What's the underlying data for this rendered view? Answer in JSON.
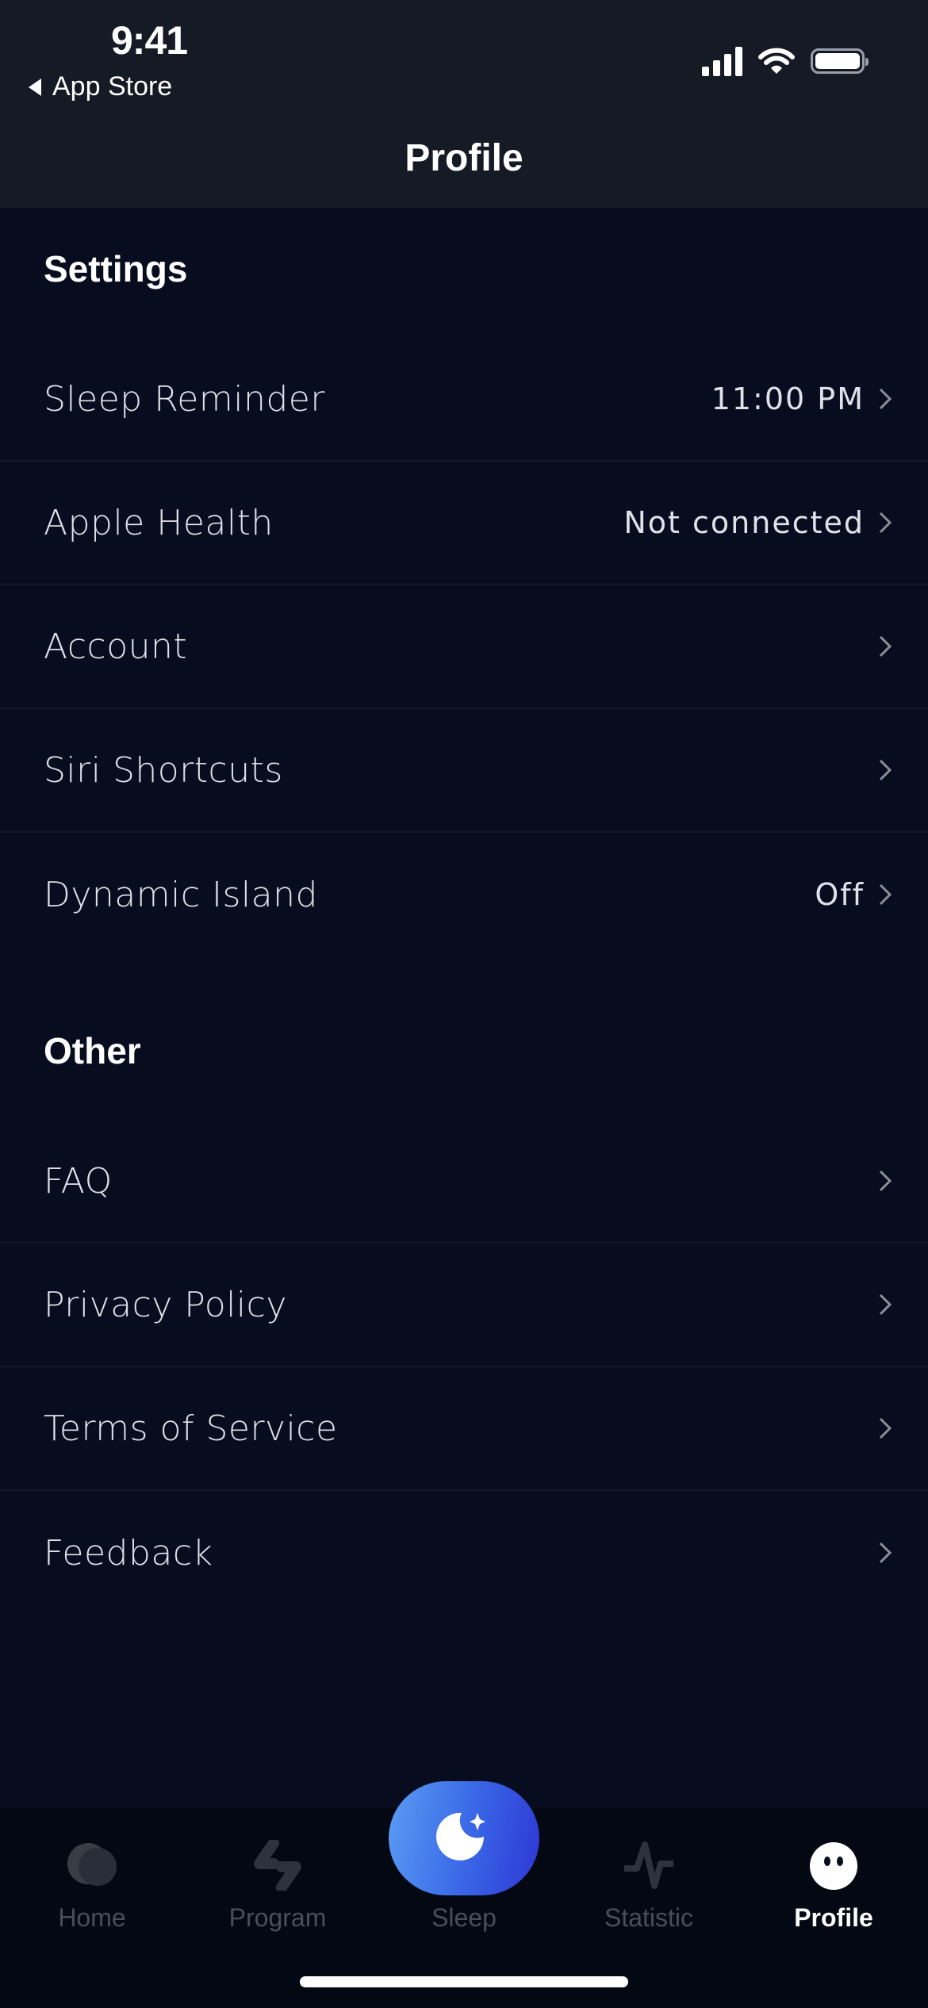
{
  "status_bar": {
    "time": "9:41",
    "back_label": "App Store"
  },
  "header": {
    "title": "Profile"
  },
  "sections": [
    {
      "title": "Settings",
      "items": [
        {
          "label": "Sleep Reminder",
          "value": "11:00 PM"
        },
        {
          "label": "Apple Health",
          "value": "Not connected"
        },
        {
          "label": "Account",
          "value": ""
        },
        {
          "label": "Siri Shortcuts",
          "value": ""
        },
        {
          "label": "Dynamic Island",
          "value": "Off"
        }
      ]
    },
    {
      "title": "Other",
      "items": [
        {
          "label": "FAQ"
        },
        {
          "label": "Privacy Policy"
        },
        {
          "label": "Terms of Service"
        },
        {
          "label": "Feedback"
        }
      ]
    }
  ],
  "tabbar": {
    "tabs": [
      {
        "label": "Home",
        "icon": "home-blob-icon",
        "active": false
      },
      {
        "label": "Program",
        "icon": "program-bolt-icon",
        "active": false
      },
      {
        "label": "Sleep",
        "icon": "moon-star-icon",
        "active": false
      },
      {
        "label": "Statistic",
        "icon": "pulse-icon",
        "active": false
      },
      {
        "label": "Profile",
        "icon": "ghost-face-icon",
        "active": true
      }
    ]
  },
  "colors": {
    "background": "#070d1e",
    "header": "#161a25",
    "accent_gradient_start": "#5b9cf3",
    "accent_gradient_end": "#2d37d4",
    "inactive_tab": "#4a4e58"
  }
}
